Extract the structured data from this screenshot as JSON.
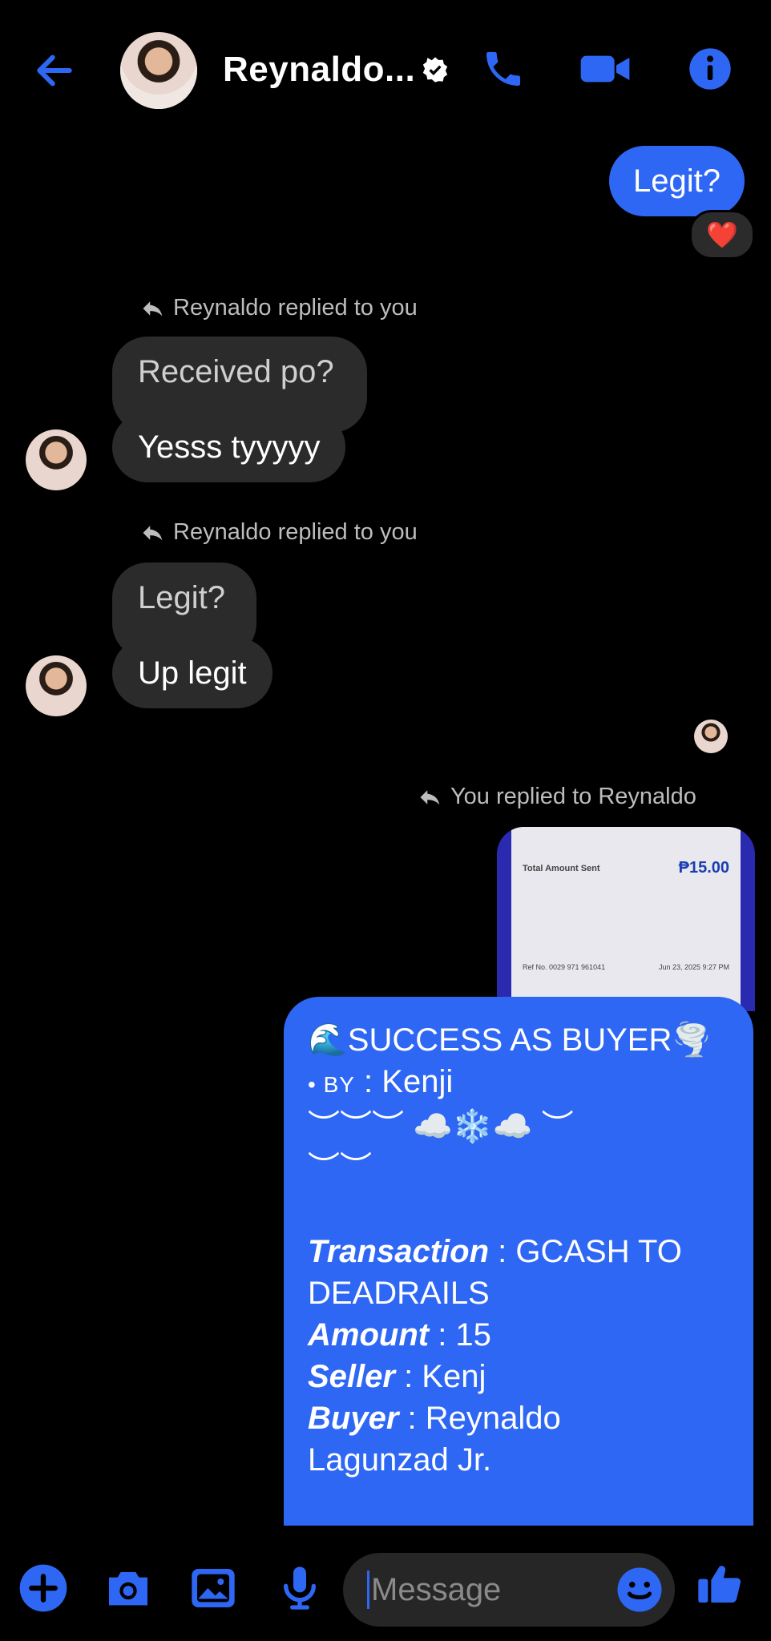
{
  "header": {
    "contact_name": "Reynaldo...",
    "accent": "#2f67f5"
  },
  "messages": {
    "m1": {
      "text": "Legit?",
      "reaction": "❤️"
    },
    "r1": {
      "note": "Reynaldo replied to you",
      "quoted": "Received po?",
      "text": "Yesss tyyyyy"
    },
    "r2": {
      "note": "Reynaldo replied to you",
      "quoted": "Legit?",
      "text": "Up legit"
    },
    "r3": {
      "note": "You replied to Reynaldo",
      "receipt": {
        "label": "Total Amount Sent",
        "amount": "₱15.00",
        "ref": "Ref No. 0029 971 961041",
        "date": "Jun 23, 2025 9:27 PM"
      },
      "lines": {
        "title": "🌊SUCCESS AS BUYER🌪️",
        "by_label": "• BY",
        "by_value": " : Kenji",
        "deco1": "︶︶︶ ☁️❄️☁️ ︶",
        "deco2": "︶︶",
        "transaction_label": "Transaction",
        "transaction_value": " : GCASH TO",
        "transaction_value2": "DEADRAILS",
        "amount_label": "Amount",
        "amount_value": " : 15",
        "seller_label": "Seller",
        "seller_value": " : Kenj",
        "buyer_label": "Buyer",
        "buyer_value": " : Reynaldo",
        "buyer_value2": "Lagunzad Jr."
      }
    }
  },
  "composer": {
    "placeholder": "Message"
  }
}
